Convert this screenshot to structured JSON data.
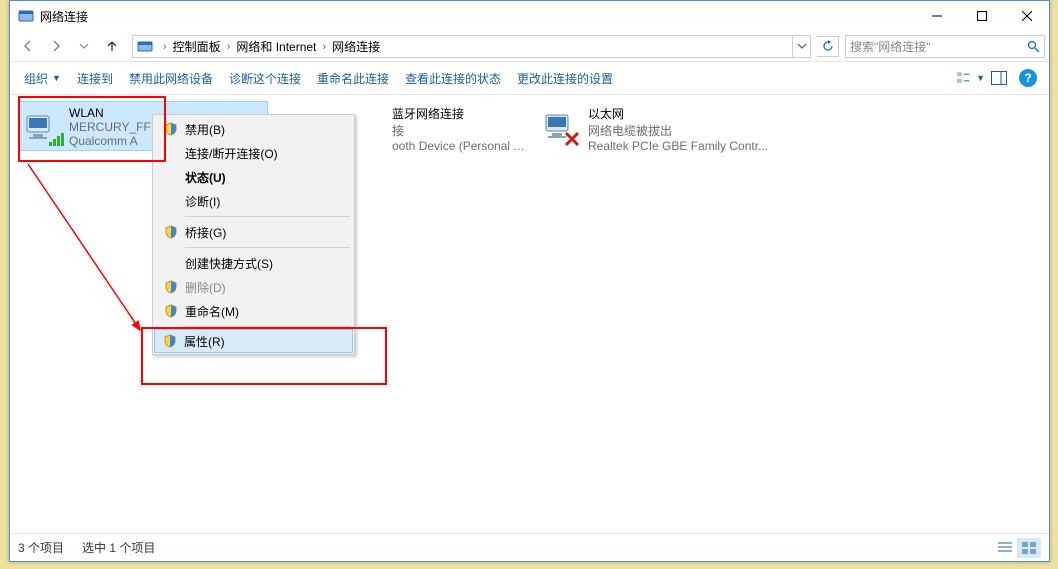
{
  "window": {
    "title": "网络连接"
  },
  "breadcrumb": {
    "root_chev": "›",
    "items": [
      "控制面板",
      "网络和 Internet",
      "网络连接"
    ]
  },
  "search": {
    "placeholder": "搜索\"网络连接\""
  },
  "cmdbar": {
    "organize": "组织",
    "connect": "连接到",
    "disable": "禁用此网络设备",
    "diagnose": "诊断这个连接",
    "rename": "重命名此连接",
    "view_status": "查看此连接的状态",
    "change": "更改此连接的设置"
  },
  "items": [
    {
      "name": "WLAN",
      "line2": "MERCURY_FF",
      "line3": "Qualcomm A",
      "status": "wifi-connected"
    },
    {
      "name": "蓝牙网络连接",
      "line2": "接",
      "line3": "ooth Device (Personal Ar...",
      "status": "bt"
    },
    {
      "name": "以太网",
      "line2": "网络电缆被拔出",
      "line3": "Realtek PCIe GBE Family Contr...",
      "status": "unplugged"
    }
  ],
  "context_menu": {
    "disable": "禁用(B)",
    "connect_disconnect": "连接/断开连接(O)",
    "status": "状态(U)",
    "diagnose": "诊断(I)",
    "bridge": "桥接(G)",
    "shortcut": "创建快捷方式(S)",
    "delete": "删除(D)",
    "rename": "重命名(M)",
    "properties": "属性(R)"
  },
  "statusbar": {
    "count": "3 个项目",
    "selection": "选中 1 个项目"
  }
}
